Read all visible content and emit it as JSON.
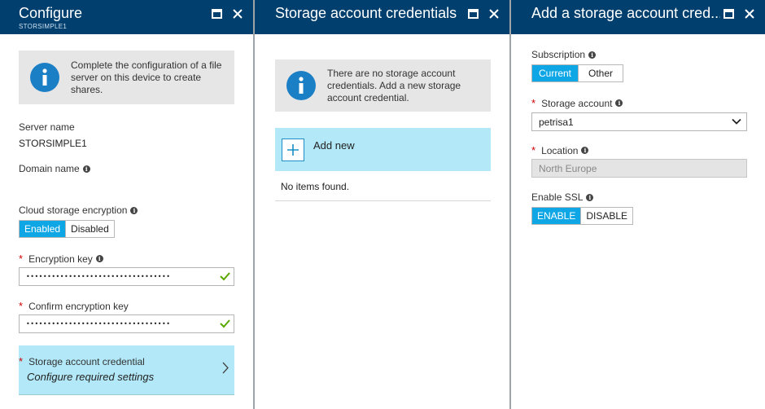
{
  "configure": {
    "title": "Configure",
    "subtitle": "STORSIMPLE1",
    "info": "Complete the configuration of a file server on this device to create shares.",
    "server_name_label": "Server name",
    "server_name_value": "STORSIMPLE1",
    "domain_name_label": "Domain name",
    "cloud_encryption_label": "Cloud storage encryption",
    "enabled_label": "Enabled",
    "disabled_label": "Disabled",
    "encryption_key_label": "Encryption key",
    "encryption_key_value": "••••••••••••••••••••••••••••••••••",
    "confirm_key_label": "Confirm encryption key",
    "confirm_key_value": "••••••••••••••••••••••••••••••••••",
    "credential_label": "Storage account credential",
    "credential_value": "Configure required settings"
  },
  "credentials": {
    "title": "Storage account credentials",
    "info": "There are no storage account credentials. Add a new storage account credential.",
    "add_new": "Add new",
    "empty": "No items found."
  },
  "add_credential": {
    "title": "Add a storage account cred...",
    "subscription_label": "Subscription",
    "current_label": "Current",
    "other_label": "Other",
    "storage_account_label": "Storage account",
    "storage_account_value": "petrisa1",
    "location_label": "Location",
    "location_value": "North Europe",
    "ssl_label": "Enable SSL",
    "enable_label": "ENABLE",
    "disable_label": "DISABLE"
  },
  "colors": {
    "header": "#003f6e",
    "accent": "#0fa6e6",
    "selected_row": "#b2e8f7",
    "info_icon": "#1b7fc6"
  }
}
